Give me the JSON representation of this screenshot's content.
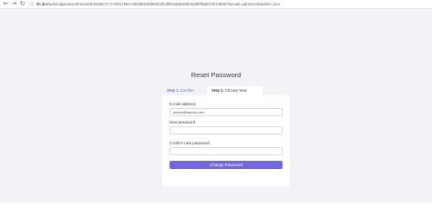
{
  "browser": {
    "back_icon": "arrow-left",
    "forward_icon": "arrow-right",
    "reload_icon": "reload",
    "url_host": "lht.dev",
    "url_path": "/admin/password/reset/dfcb0e9e7c7c79017994-3383f6935f9602dfcd6f33a693e82348f0ff6db7207390879email=admin%40admin.com"
  },
  "page": {
    "title": "Reset Password"
  },
  "tabs": [
    {
      "step": "Step 1.",
      "label": "Confirm Email"
    },
    {
      "step": "Step 2.",
      "label": "Choose New Password"
    }
  ],
  "form": {
    "email_label": "E-mail address",
    "email_value": "admin@admin.com",
    "new_password_label": "New password",
    "confirm_password_label": "Confirm new password",
    "submit_label": "Change Password"
  },
  "colors": {
    "accent": "#7466e0",
    "background": "#f3f3f7",
    "inactive_tab": "#5f7fa8"
  }
}
